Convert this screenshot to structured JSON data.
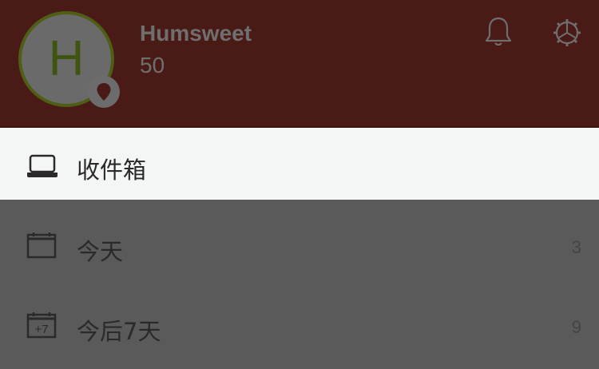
{
  "profile": {
    "avatar_letter": "H",
    "username": "Humsweet",
    "points": "50"
  },
  "header": {
    "icons": [
      "bell-icon",
      "gear-icon"
    ],
    "colors": {
      "background": "#4a1a16",
      "avatar_ring": "#4e5e14"
    }
  },
  "menu": {
    "items": [
      {
        "label": "收件箱",
        "count": "",
        "icon": "inbox-icon",
        "selected": true
      },
      {
        "label": "今天",
        "count": "3",
        "icon": "calendar-icon",
        "selected": false
      },
      {
        "label": "今后7天",
        "count": "9",
        "icon": "calendar-plus7-icon",
        "selected": false
      }
    ],
    "next7_icon_text": "+7"
  }
}
